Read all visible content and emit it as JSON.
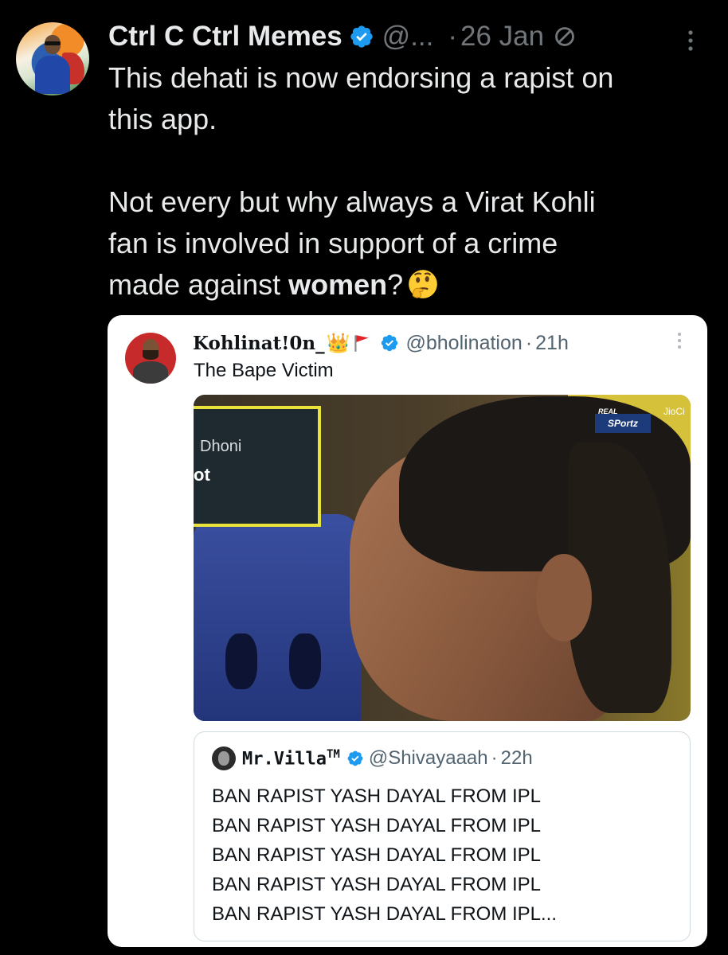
{
  "post": {
    "author_name": "Ctrl C Ctrl Memes",
    "handle": "@...",
    "separator": "·",
    "time": "26 Jan",
    "text_line1": "This dehati is now endorsing a rapist on",
    "text_line2": "this app.",
    "text_para2_line1": "Not every but why always a Virat Kohli",
    "text_para2_line2": "fan is involved in support of a crime",
    "text_para2_line3_prefix": "made against ",
    "text_para2_bold": "women",
    "text_para2_suffix": "?",
    "emoji": "thinking-face-icon"
  },
  "quoted_post": {
    "author_name": "Kohlinat!0n_",
    "badges": [
      "crown-icon",
      "red-flag-icon"
    ],
    "handle": "@bholination",
    "separator": "·",
    "time": "21h",
    "text": "The Bape Victim",
    "media": {
      "card_text1": "Dhoni",
      "card_text2": "ot",
      "logo_top": "REAL",
      "logo": "SPortz",
      "jio": "JioCi"
    }
  },
  "nested_quote": {
    "author_name": "Mr.Villa",
    "trademark": "TM",
    "handle": "@Shivayaaah",
    "separator": "·",
    "time": "22h",
    "lines": [
      "BAN RAPIST YASH DAYAL FROM IPL",
      "BAN RAPIST YASH DAYAL FROM IPL",
      "BAN RAPIST YASH DAYAL FROM IPL",
      "BAN RAPIST YASH DAYAL FROM IPL",
      "BAN RAPIST YASH DAYAL FROM IPL..."
    ]
  },
  "colors": {
    "background": "#000000",
    "text_primary": "#e7e9ea",
    "text_secondary": "#71767b",
    "verified": "#1d9bf0",
    "card_bg": "#ffffff"
  }
}
